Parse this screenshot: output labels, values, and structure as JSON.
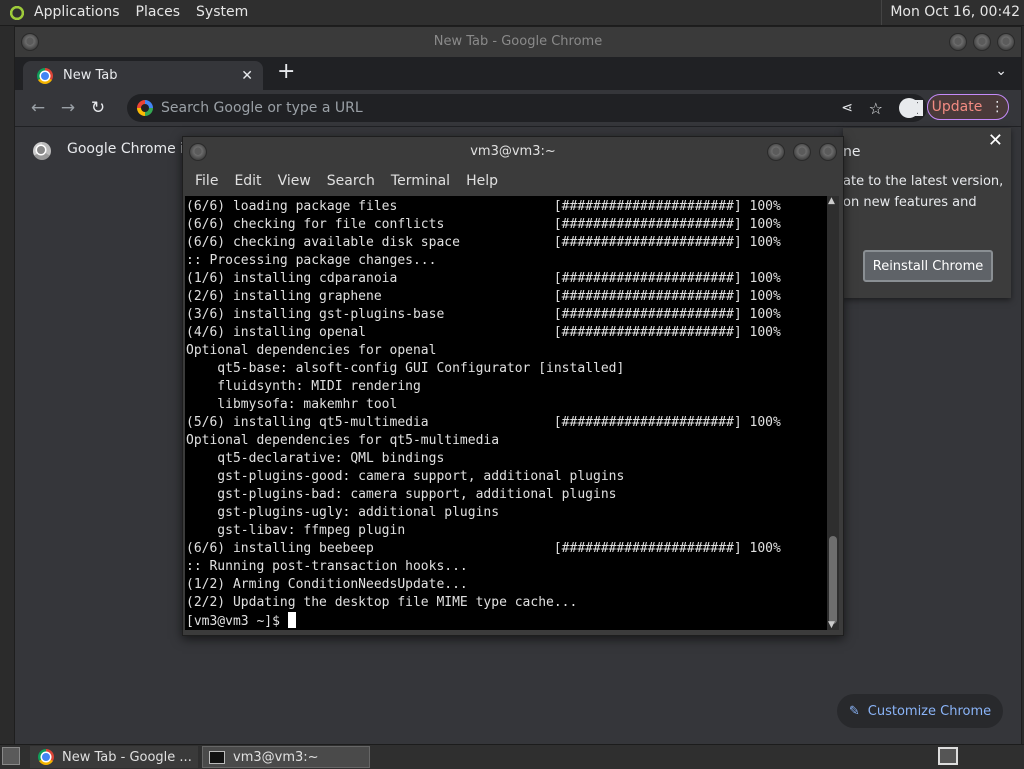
{
  "top_panel": {
    "menus": [
      "Applications",
      "Places",
      "System"
    ],
    "clock": "Mon Oct 16, 00:42"
  },
  "chrome": {
    "window_title": "New Tab - Google Chrome",
    "tab_title": "New Tab",
    "omnibox_placeholder": "Search Google or type a URL",
    "update_label": "Update",
    "infobar_text": "Google Chrome isn",
    "popup": {
      "line1": "ne",
      "line2": "ate to the latest version,",
      "line3": "on new features and",
      "reinstall_label": "Reinstall Chrome"
    },
    "customize_label": "Customize Chrome"
  },
  "terminal": {
    "window_title": "vm3@vm3:~",
    "menus": [
      "File",
      "Edit",
      "View",
      "Search",
      "Terminal",
      "Help"
    ],
    "lines": [
      "(6/6) loading package files                    [######################] 100%",
      "(6/6) checking for file conflicts              [######################] 100%",
      "(6/6) checking available disk space            [######################] 100%",
      ":: Processing package changes...",
      "(1/6) installing cdparanoia                    [######################] 100%",
      "(2/6) installing graphene                      [######################] 100%",
      "(3/6) installing gst-plugins-base              [######################] 100%",
      "(4/6) installing openal                        [######################] 100%",
      "Optional dependencies for openal",
      "    qt5-base: alsoft-config GUI Configurator [installed]",
      "    fluidsynth: MIDI rendering",
      "    libmysofa: makemhr tool",
      "(5/6) installing qt5-multimedia                [######################] 100%",
      "Optional dependencies for qt5-multimedia",
      "    qt5-declarative: QML bindings",
      "    gst-plugins-good: camera support, additional plugins",
      "    gst-plugins-bad: camera support, additional plugins",
      "    gst-plugins-ugly: additional plugins",
      "    gst-libav: ffmpeg plugin",
      "(6/6) installing beebeep                       [######################] 100%",
      ":: Running post-transaction hooks...",
      "(1/2) Arming ConditionNeedsUpdate...",
      "(2/2) Updating the desktop file MIME type cache..."
    ],
    "prompt": "[vm3@vm3 ~]$ "
  },
  "taskbar": {
    "items": [
      "New Tab - Google ...",
      "vm3@vm3:~"
    ]
  }
}
